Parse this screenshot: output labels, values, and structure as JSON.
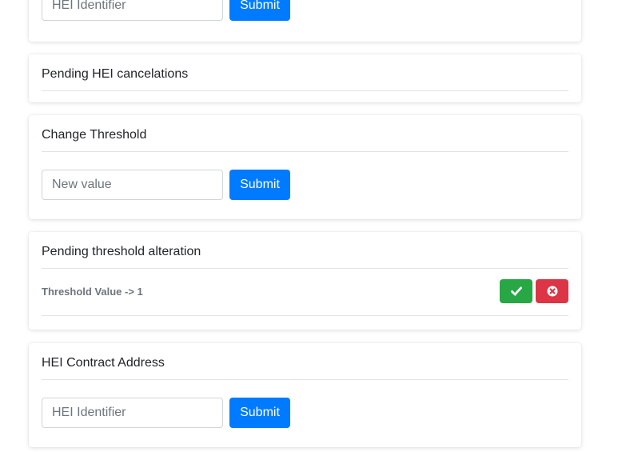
{
  "hei_lookup": {
    "input_placeholder": "HEI Identifier",
    "submit_label": "Submit"
  },
  "pending_cancelations": {
    "title": "Pending HEI cancelations"
  },
  "change_threshold": {
    "title": "Change Threshold",
    "input_placeholder": "New value",
    "submit_label": "Submit"
  },
  "pending_threshold": {
    "title": "Pending threshold alteration",
    "items": [
      {
        "label": "Threshold Value -> 1",
        "approve_icon": "check-icon",
        "reject_icon": "times-circle-icon"
      }
    ]
  },
  "hei_contract_address": {
    "title": "HEI Contract Address",
    "input_placeholder": "HEI Identifier",
    "submit_label": "Submit"
  },
  "colors": {
    "primary": "#007bff",
    "success": "#28a745",
    "danger": "#dc3545"
  }
}
